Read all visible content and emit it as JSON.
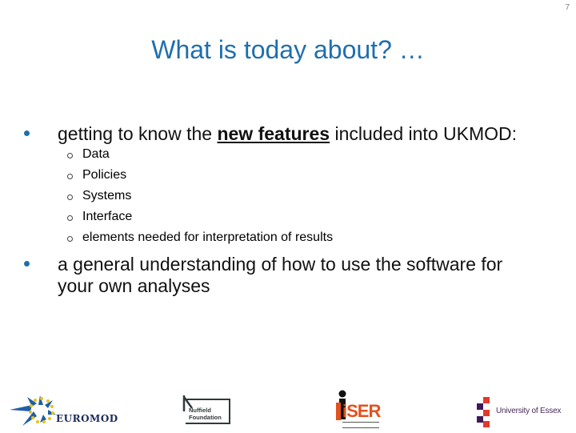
{
  "page_number": "7",
  "title": "What is today about? …",
  "bullets": [
    {
      "prefix": "getting to know the ",
      "emphasis": "new features",
      "suffix": " included into UKMOD:",
      "sub_items": [
        "Data",
        "Policies",
        "Systems",
        "Interface",
        "elements needed for interpretation of results"
      ]
    },
    {
      "line1": "a general understanding of how to use the software for",
      "line2": "your own analyses"
    }
  ],
  "logos": {
    "euromod": "EUROMOD",
    "nuffield_line1": "Nuffield",
    "nuffield_line2": "Foundation",
    "iser": "iSER",
    "essex": "University of Essex"
  },
  "colors": {
    "title": "#1f6fad",
    "bullet": "#1f6fad",
    "iser_orange": "#e2521d",
    "essex_red": "#e03a2e",
    "essex_purple": "#3d1a55"
  }
}
